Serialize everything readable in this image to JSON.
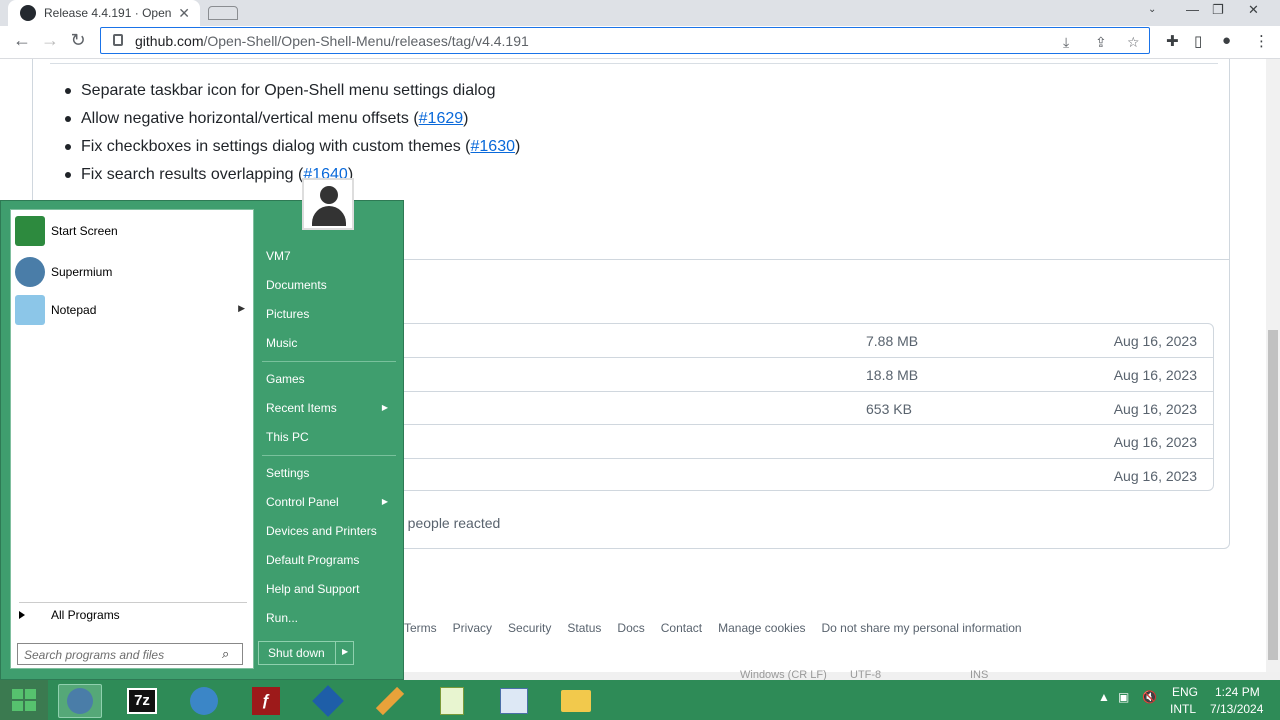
{
  "browser": {
    "tab_title": "Release 4.4.191 · Open",
    "tab_close": "✕",
    "url_host": "github.com",
    "url_path": "/Open-Shell/Open-Shell-Menu/releases/tag/v4.4.191"
  },
  "release": {
    "bullets": [
      {
        "text": "Separate taskbar icon for Open-Shell menu settings dialog",
        "ref": ""
      },
      {
        "text": "Allow negative horizontal/vertical menu offsets (",
        "ref": "#1629",
        "end": ")"
      },
      {
        "text": "Fix checkboxes in settings dialog with custom themes (",
        "ref": "#1630",
        "end": ")"
      },
      {
        "text": "Fix search results overlapping (",
        "ref": "#1640",
        "end": ")"
      }
    ],
    "assets": [
      {
        "size": "7.88 MB",
        "date": "Aug 16, 2023"
      },
      {
        "size": "18.8 MB",
        "date": "Aug 16, 2023"
      },
      {
        "size": "653 KB",
        "date": "Aug 16, 2023"
      },
      {
        "size": "",
        "date": "Aug 16, 2023"
      },
      {
        "size": "",
        "date": "Aug 16, 2023"
      }
    ],
    "reactions": "5 people reacted"
  },
  "footer": [
    "Terms",
    "Privacy",
    "Security",
    "Status",
    "Docs",
    "Contact",
    "Manage cookies",
    "Do not share my personal information"
  ],
  "start_menu": {
    "programs": [
      {
        "label": "Start Screen",
        "icon": "start-screen-icon",
        "color": "#2d8a3e"
      },
      {
        "label": "Supermium",
        "icon": "supermium-icon",
        "color": "#4a7da8"
      },
      {
        "label": "Notepad",
        "icon": "notepad-icon",
        "color": "#8cc6e8",
        "submenu": true
      }
    ],
    "all_programs": "All Programs",
    "search_placeholder": "Search programs and files",
    "right_items": [
      {
        "label": "VM7"
      },
      {
        "label": "Documents"
      },
      {
        "label": "Pictures"
      },
      {
        "label": "Music"
      },
      {
        "label": "Games"
      },
      {
        "label": "Recent Items",
        "submenu": true
      },
      {
        "label": "This PC"
      },
      {
        "label": "Settings"
      },
      {
        "label": "Control Panel",
        "submenu": true
      },
      {
        "label": "Devices and Printers"
      },
      {
        "label": "Default Programs"
      },
      {
        "label": "Help and Support"
      },
      {
        "label": "Run..."
      }
    ],
    "shutdown": "Shut down"
  },
  "taskbar": {
    "apps": [
      "supermium",
      "7z",
      "internet-download-manager",
      "flash",
      "virtualbox",
      "pencil-tool",
      "notepad-plus",
      "paint",
      "file-explorer"
    ],
    "lang_top": "ENG",
    "lang_bottom": "INTL",
    "time": "1:24 PM",
    "date": "7/13/2024"
  },
  "notepad_status": {
    "line_endings": "Windows (CR LF)",
    "encoding": "UTF-8",
    "mode": "INS"
  }
}
